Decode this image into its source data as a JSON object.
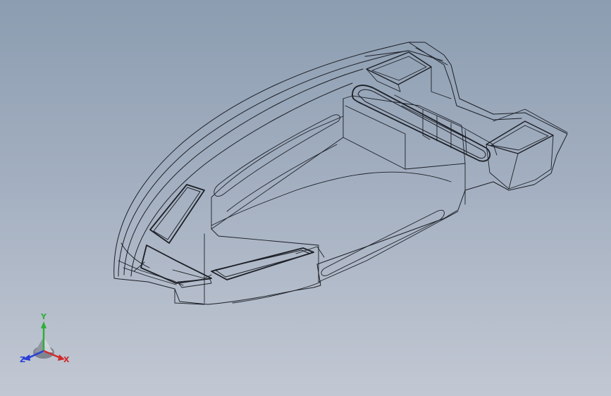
{
  "view": {
    "background_top": "#8c9db1",
    "background_bottom": "#c2c8d3",
    "edge_color": "#1c1f26",
    "hidden_edge_color": "#3a3f4a"
  },
  "model": {
    "icon": "boat-hull-wireframe"
  },
  "triad": {
    "icon": "coordinate-triad-icon",
    "x_label": "X",
    "y_label": "Y",
    "z_label": "Z",
    "x_color": "#d12b2b",
    "y_color": "#2fae3a",
    "z_color": "#2a3fd6"
  }
}
